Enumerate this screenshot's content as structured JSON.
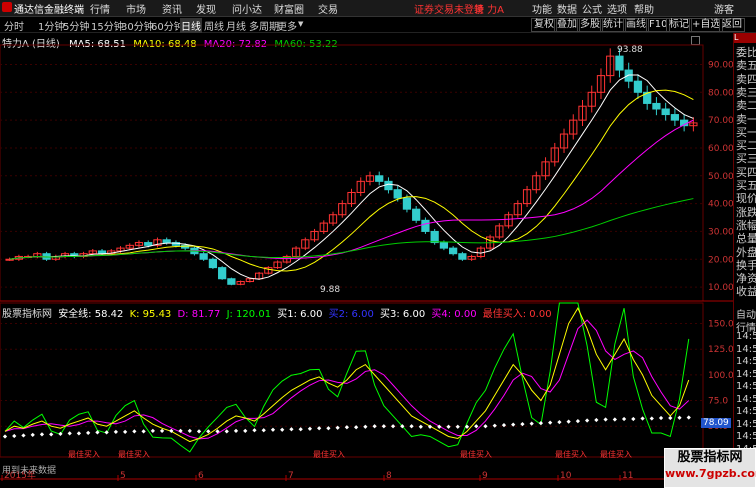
{
  "topbar": {
    "app_name": "通达信金融终端",
    "menus": [
      "行情",
      "市场",
      "资讯",
      "发现",
      "问小达",
      "财富圈",
      "交易"
    ],
    "login_status": "证券交易未登录",
    "stock_name": "特 力A",
    "right_menus": [
      "功能",
      "数据",
      "公式",
      "选项",
      "帮助",
      "游客"
    ]
  },
  "toolbar": {
    "periods": [
      "分时",
      "1分钟",
      "5分钟",
      "15分钟",
      "30分钟",
      "60分钟",
      "日线",
      "周线",
      "月线",
      "多周期",
      "更多"
    ],
    "active_period": "日线",
    "right_buttons": [
      "复权",
      "叠加",
      "多股",
      "统计",
      "画线",
      "F10",
      "标记",
      "+自选",
      "返回"
    ]
  },
  "main_chart": {
    "title": "特力A (日线)",
    "ma": [
      {
        "label": "MA5: 68.51",
        "color": "#ffffff"
      },
      {
        "label": "MA10: 68.48",
        "color": "#ffff00"
      },
      {
        "label": "MA20: 72.82",
        "color": "#ff00ff"
      },
      {
        "label": "MA60: 53.22",
        "color": "#00cc00"
      }
    ],
    "y_ticks": [
      "90.00",
      "80.00",
      "70.00",
      "60.00",
      "50.00",
      "40.00",
      "30.00",
      "20.00",
      "10.00"
    ],
    "high_label": "93.88",
    "low_label": "9.88"
  },
  "indicator": {
    "title": "股票指标网",
    "items": [
      {
        "label": "安全线: 58.42",
        "color": "#ffffff"
      },
      {
        "label": "K: 95.43",
        "color": "#ffff00"
      },
      {
        "label": "D: 81.77",
        "color": "#ff00ff"
      },
      {
        "label": "J: 120.01",
        "color": "#00ff00"
      },
      {
        "label": "买1: 6.00",
        "color": "#ffffff"
      },
      {
        "label": "买2: 6.00",
        "color": "#0000ff"
      },
      {
        "label": "买3: 6.00",
        "color": "#ffffff"
      },
      {
        "label": "买4: 0.00",
        "color": "#ff00ff"
      },
      {
        "label": "最佳买入: 0.00",
        "color": "#ff3333"
      }
    ],
    "y_ticks": [
      "150.0",
      "125.0",
      "100.0",
      "75.0",
      "50.0"
    ],
    "current_value": "78.09",
    "buy_signal_label": "最佳买入",
    "footer_text": "用到未来数据"
  },
  "x_labels": [
    "2015年",
    "5",
    "6",
    "7",
    "8",
    "9",
    "10",
    "11"
  ],
  "side_panel": {
    "header": "L",
    "items": [
      "委比",
      "卖五",
      "卖四",
      "卖三",
      "卖二",
      "卖一",
      "买一",
      "买二",
      "买三",
      "买四",
      "买五",
      "现价",
      "涨跌",
      "涨幅",
      "总量",
      "外盘",
      "换手",
      "净资",
      "收益"
    ],
    "lower_items": [
      "自动",
      "行情",
      "14:5",
      "14:5",
      "14:5",
      "14:5",
      "14:5",
      "14:5",
      "14:5",
      "14:5",
      "14:5",
      "14:5",
      "14:5",
      "14:5"
    ]
  },
  "watermark": {
    "line1": "股票指标网",
    "line2": "www.7gpzb.com"
  },
  "chart_data": {
    "type": "line",
    "title": "特力A (日线)",
    "x": [
      "2015年",
      "5",
      "6",
      "7",
      "8",
      "9",
      "10",
      "11"
    ],
    "price_ylim": [
      5,
      97
    ],
    "candle_close_series": [
      20,
      21,
      21,
      22,
      20,
      21,
      22,
      21,
      22,
      23,
      22,
      23,
      24,
      25,
      26,
      25,
      27,
      26,
      25,
      24,
      22,
      20,
      17,
      13,
      11,
      12,
      13,
      15,
      17,
      19,
      21,
      24,
      27,
      30,
      33,
      36,
      40,
      44,
      48,
      50,
      48,
      45,
      42,
      38,
      34,
      30,
      26,
      24,
      22,
      20,
      21,
      24,
      28,
      32,
      36,
      40,
      45,
      50,
      55,
      60,
      65,
      70,
      75,
      80,
      86,
      93,
      88,
      84,
      80,
      76,
      74,
      72,
      70,
      68,
      69
    ],
    "ma_lines": [
      "MA5",
      "MA10",
      "MA20",
      "MA60"
    ],
    "indicator_ylim": [
      20,
      170
    ],
    "kdj_k_series": [
      45,
      50,
      48,
      52,
      55,
      50,
      48,
      52,
      55,
      58,
      52,
      50,
      55,
      60,
      65,
      58,
      52,
      48,
      45,
      40,
      35,
      38,
      42,
      48,
      55,
      60,
      58,
      55,
      62,
      70,
      78,
      85,
      90,
      95,
      98,
      92,
      88,
      95,
      105,
      110,
      100,
      90,
      80,
      70,
      60,
      55,
      50,
      45,
      40,
      38,
      45,
      55,
      65,
      80,
      95,
      110,
      100,
      85,
      75,
      90,
      120,
      150,
      165,
      145,
      120,
      105,
      120,
      135,
      115,
      100,
      80,
      70,
      60,
      70,
      95
    ],
    "safety_line_series": [
      40,
      40.5,
      41,
      41.5,
      42,
      42,
      42.5,
      43,
      43,
      43.5,
      44,
      44,
      44.5,
      44.5,
      45,
      45,
      45.5,
      45.5,
      45.5,
      45.5,
      45.5,
      45,
      45,
      45,
      45,
      45.5,
      45.5,
      46,
      46,
      46.5,
      46.5,
      47,
      47,
      47.5,
      48,
      48,
      48.5,
      49,
      49,
      49.5,
      50,
      50,
      50,
      50,
      50,
      49.5,
      49.5,
      49.5,
      49.5,
      49.5,
      49.5,
      50,
      50,
      50.5,
      51,
      51.5,
      52,
      52.5,
      53,
      53.5,
      54,
      54.5,
      55,
      55.5,
      56,
      56.5,
      56.5,
      57,
      57,
      57.5,
      57.5,
      58,
      58,
      58.2,
      58.42
    ]
  }
}
